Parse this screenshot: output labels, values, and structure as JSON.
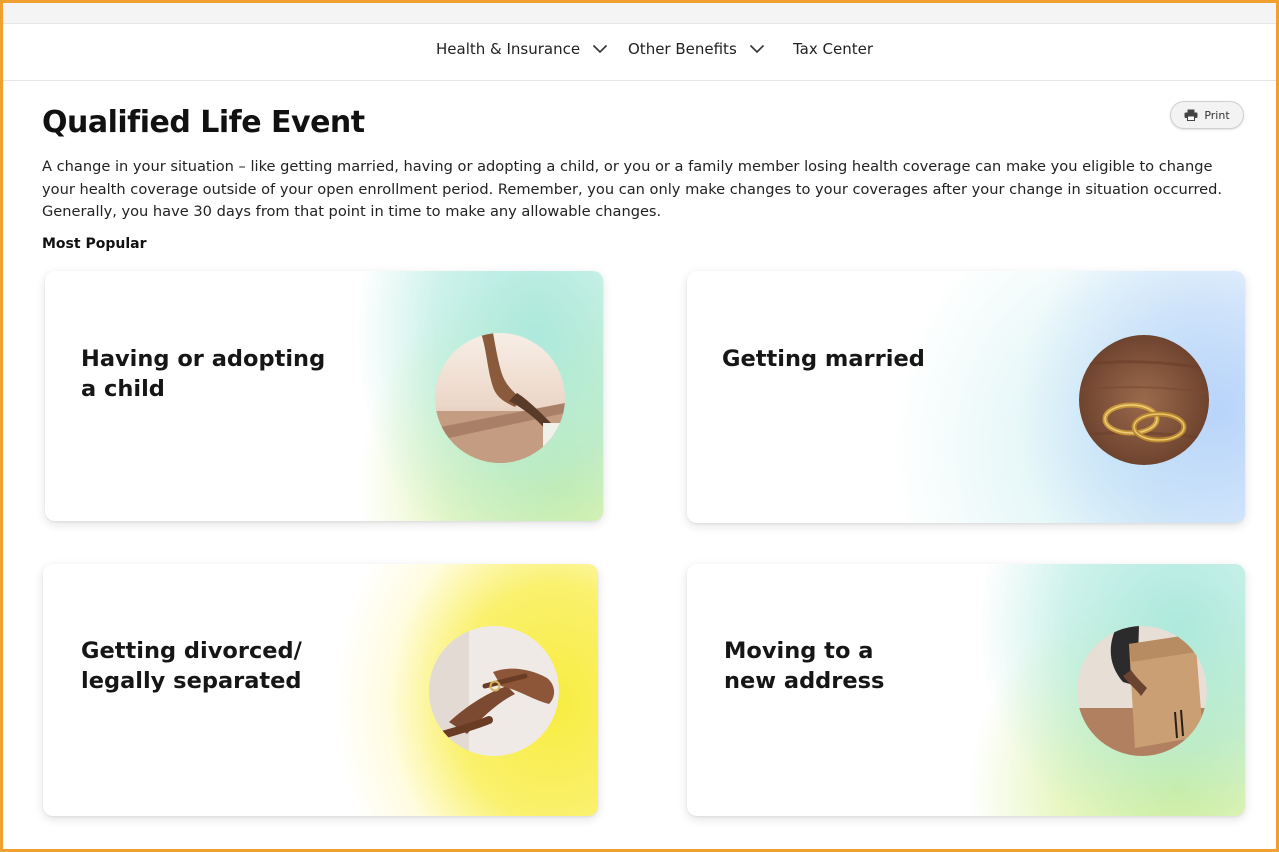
{
  "nav": {
    "items": [
      {
        "label": "Health & Insurance",
        "has_dropdown": true,
        "icon": "chevron-down-icon"
      },
      {
        "label": "Other Benefits",
        "has_dropdown": true,
        "icon": "chevron-down-icon"
      },
      {
        "label": "Tax Center",
        "has_dropdown": false
      }
    ]
  },
  "page": {
    "title": "Qualified Life Event",
    "print_label": "Print",
    "print_icon": "printer-icon",
    "intro": "A change in your situation – like getting married, having or adopting a child, or you or a family member losing health coverage can make you eligible to change your health coverage outside of your open enrollment period. Remember, you can only make changes to your coverages after your change in situation occurred. Generally, you have 30 days from that point in time to make any allowable changes.",
    "section_label": "Most Popular"
  },
  "cards": [
    {
      "title": "Having or adopting\na child",
      "image": "holding-hands-photo",
      "accent": [
        "#a9e8dc",
        "#d4ef8e"
      ]
    },
    {
      "title": "Getting married",
      "image": "wedding-rings-photo",
      "accent": [
        "#d8f3f4",
        "#b6d2fa"
      ]
    },
    {
      "title": "Getting divorced/\nlegally separated",
      "image": "removing-ring-photo",
      "accent": [
        "#fff7a8",
        "#f8ec3c"
      ]
    },
    {
      "title": "Moving to a\nnew address",
      "image": "moving-box-photo",
      "accent": [
        "#a9e8dc",
        "#d4ef8e"
      ]
    }
  ],
  "colors": {
    "frame_border": "#f0a030",
    "text": "#111111"
  }
}
